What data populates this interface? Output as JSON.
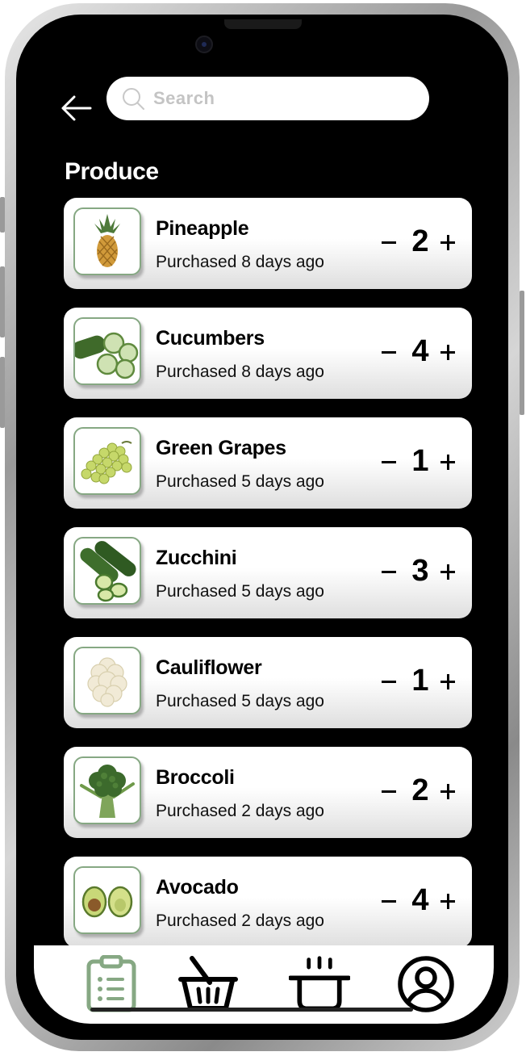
{
  "header": {
    "back_icon": "arrow-left-icon",
    "search_placeholder": "Search",
    "search_icon": "search-icon"
  },
  "section": {
    "title": "Produce",
    "items": [
      {
        "name": "Pineapple",
        "purchased": "Purchased 8 days ago",
        "qty": "2",
        "image": "pineapple"
      },
      {
        "name": "Cucumbers",
        "purchased": "Purchased 8 days ago",
        "qty": "4",
        "image": "cucumbers"
      },
      {
        "name": "Green Grapes",
        "purchased": "Purchased 5 days ago",
        "qty": "1",
        "image": "green-grapes"
      },
      {
        "name": "Zucchini",
        "purchased": "Purchased 5 days ago",
        "qty": "3",
        "image": "zucchini"
      },
      {
        "name": "Cauliflower",
        "purchased": "Purchased 5 days ago",
        "qty": "1",
        "image": "cauliflower"
      },
      {
        "name": "Broccoli",
        "purchased": "Purchased 2 days ago",
        "qty": "2",
        "image": "broccoli"
      },
      {
        "name": "Avocado",
        "purchased": "Purchased 2 days ago",
        "qty": "4",
        "image": "avocado"
      }
    ]
  },
  "tabbar": {
    "tabs": [
      {
        "name": "list",
        "icon": "clipboard-list-icon",
        "active": true
      },
      {
        "name": "basket",
        "icon": "basket-icon",
        "active": false
      },
      {
        "name": "pot",
        "icon": "cooking-pot-icon",
        "active": false
      },
      {
        "name": "profile",
        "icon": "user-circle-icon",
        "active": false
      }
    ]
  },
  "colors": {
    "accent": "#86a883",
    "background": "#000000",
    "card": "#ffffff"
  }
}
